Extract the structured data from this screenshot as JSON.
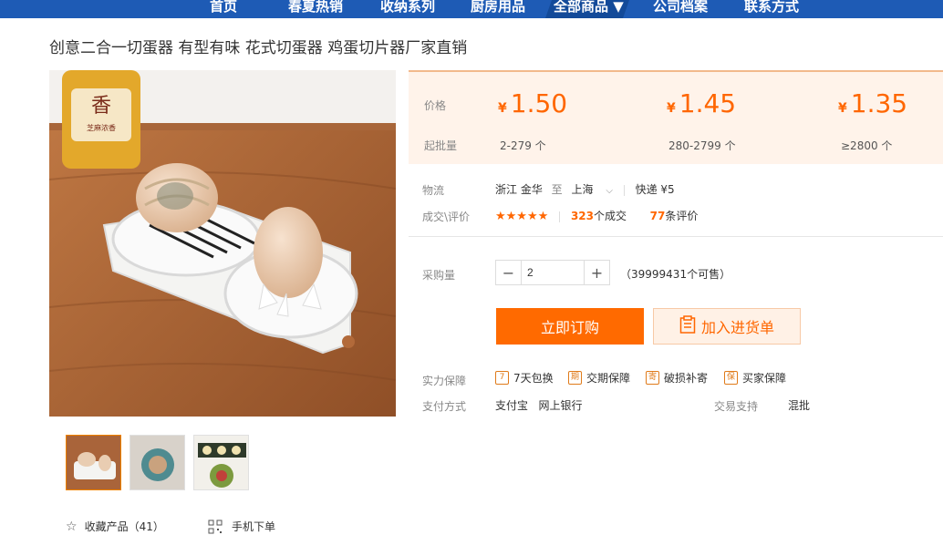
{
  "nav": {
    "items": [
      "首页",
      "春夏热销",
      "收纳系列",
      "厨房用品",
      "全部商品 ▼",
      "公司档案",
      "联系方式"
    ]
  },
  "product": {
    "title": "创意二合一切蛋器 有型有味 花式切蛋器 鸡蛋切片器厂家直销"
  },
  "pricing": {
    "price_label": "价格",
    "moq_label": "起批量",
    "currency": "¥",
    "tiers": [
      {
        "price": "1.50",
        "range": "2-279 个"
      },
      {
        "price": "1.45",
        "range": "280-2799 个"
      },
      {
        "price": "1.35",
        "range": "≥2800 个"
      }
    ]
  },
  "logistics": {
    "label": "物流",
    "from": "浙江 金华",
    "to_word": "至",
    "to": "上海",
    "method": "快递 ¥5"
  },
  "reviews": {
    "label": "成交\\评价",
    "stars": "★★★★★",
    "deals_count": "323",
    "deals_suffix": "个成交",
    "reviews_count": "77",
    "reviews_suffix": "条评价"
  },
  "purchase": {
    "label": "采购量",
    "quantity": "2",
    "minus": "−",
    "plus": "+",
    "available": "（39999431个可售）",
    "buy_button": "立即订购",
    "cart_button": "加入进货单"
  },
  "guarantees": {
    "label": "实力保障",
    "items": [
      {
        "icon": "7",
        "text": "7天包换"
      },
      {
        "icon": "期",
        "text": "交期保障"
      },
      {
        "icon": "寄",
        "text": "破损补寄"
      },
      {
        "icon": "保",
        "text": "买家保障"
      }
    ]
  },
  "payment": {
    "label": "支付方式",
    "methods": "支付宝   网上银行",
    "support_label": "交易支持",
    "support_value": "混批"
  },
  "footer": {
    "favorite": "收藏产品（41）",
    "mobile_order": "手机下单"
  },
  "colors": {
    "nav_bg": "#1e5bb5",
    "accent": "#ff6600",
    "price_bg": "#fff3ea"
  }
}
